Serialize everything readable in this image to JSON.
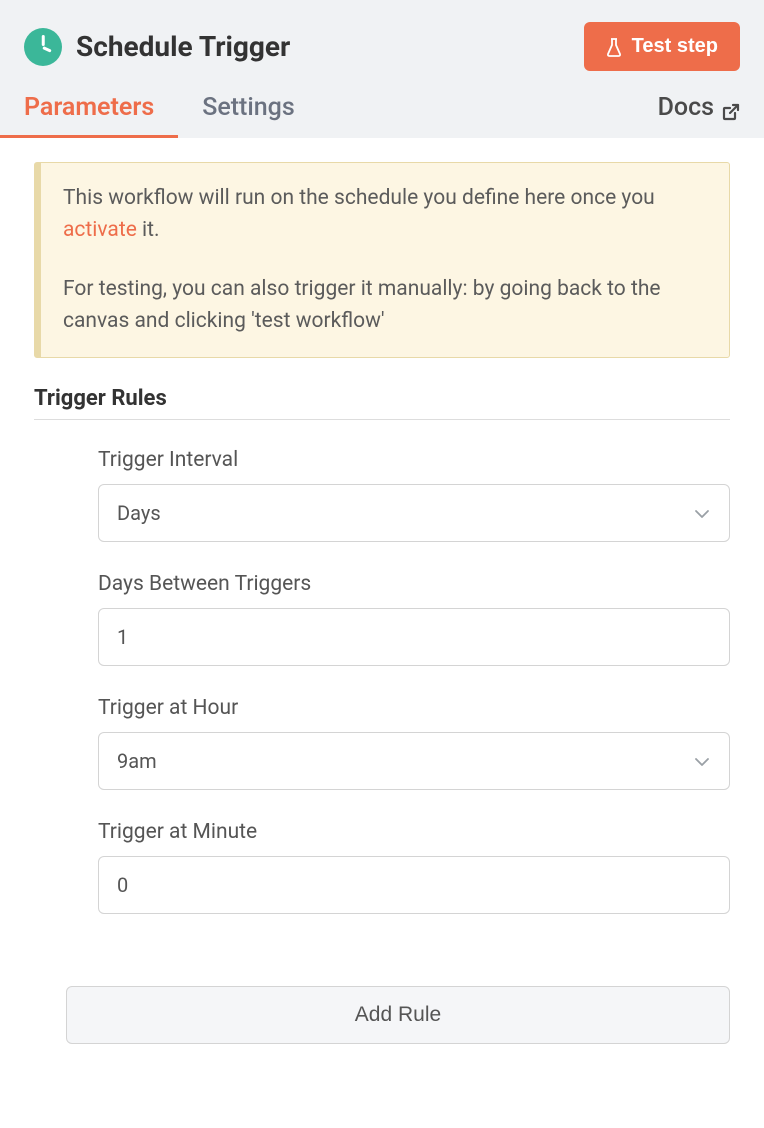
{
  "header": {
    "title": "Schedule Trigger",
    "test_button": "Test step"
  },
  "tabs": {
    "parameters": "Parameters",
    "settings": "Settings",
    "docs": "Docs"
  },
  "callout": {
    "line1_prefix": "This workflow will run on the schedule you define here once you ",
    "activate": "activate",
    "line1_suffix": " it.",
    "line2": "For testing, you can also trigger it manually: by going back to the canvas and clicking 'test workflow'"
  },
  "section": {
    "title": "Trigger Rules"
  },
  "form": {
    "interval_label": "Trigger Interval",
    "interval_value": "Days",
    "days_between_label": "Days Between Triggers",
    "days_between_value": "1",
    "hour_label": "Trigger at Hour",
    "hour_value": "9am",
    "minute_label": "Trigger at Minute",
    "minute_value": "0",
    "add_rule": "Add Rule"
  }
}
